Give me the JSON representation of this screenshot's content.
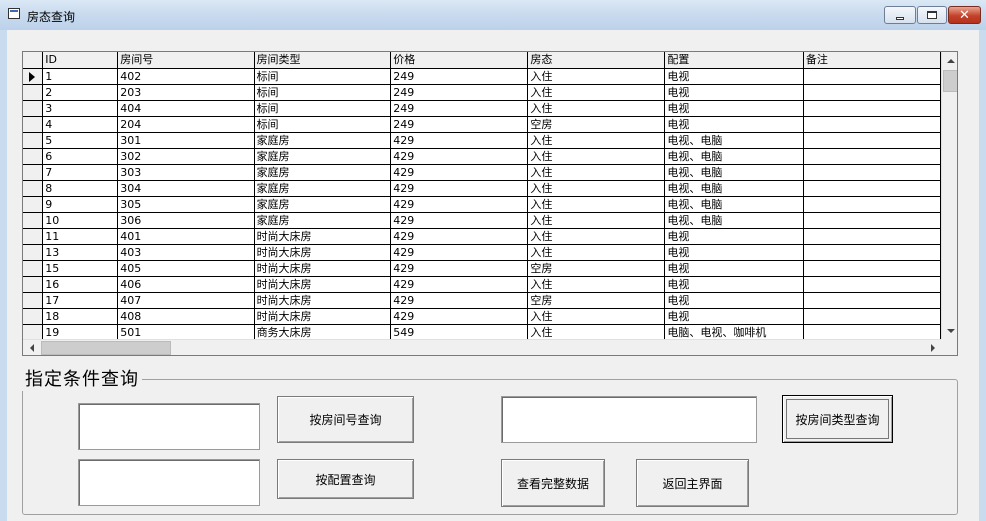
{
  "window": {
    "title": "房态查询"
  },
  "grid": {
    "columns": [
      "ID",
      "房间号",
      "房间类型",
      "价格",
      "房态",
      "配置",
      "备注"
    ],
    "rows": [
      [
        "1",
        "402",
        "标间",
        "249",
        "入住",
        "电视",
        ""
      ],
      [
        "2",
        "203",
        "标间",
        "249",
        "入住",
        "电视",
        ""
      ],
      [
        "3",
        "404",
        "标间",
        "249",
        "入住",
        "电视",
        ""
      ],
      [
        "4",
        "204",
        "标间",
        "249",
        "空房",
        "电视",
        ""
      ],
      [
        "5",
        "301",
        "家庭房",
        "429",
        "入住",
        "电视、电脑",
        ""
      ],
      [
        "6",
        "302",
        "家庭房",
        "429",
        "入住",
        "电视、电脑",
        ""
      ],
      [
        "7",
        "303",
        "家庭房",
        "429",
        "入住",
        "电视、电脑",
        ""
      ],
      [
        "8",
        "304",
        "家庭房",
        "429",
        "入住",
        "电视、电脑",
        ""
      ],
      [
        "9",
        "305",
        "家庭房",
        "429",
        "入住",
        "电视、电脑",
        ""
      ],
      [
        "10",
        "306",
        "家庭房",
        "429",
        "入住",
        "电视、电脑",
        ""
      ],
      [
        "11",
        "401",
        "时尚大床房",
        "429",
        "入住",
        "电视",
        ""
      ],
      [
        "13",
        "403",
        "时尚大床房",
        "429",
        "入住",
        "电视",
        ""
      ],
      [
        "15",
        "405",
        "时尚大床房",
        "429",
        "空房",
        "电视",
        ""
      ],
      [
        "16",
        "406",
        "时尚大床房",
        "429",
        "入住",
        "电视",
        ""
      ],
      [
        "17",
        "407",
        "时尚大床房",
        "429",
        "空房",
        "电视",
        ""
      ],
      [
        "18",
        "408",
        "时尚大床房",
        "429",
        "入住",
        "电视",
        ""
      ],
      [
        "19",
        "501",
        "商务大床房",
        "549",
        "入住",
        "电脑、电视、咖啡机",
        ""
      ]
    ]
  },
  "search": {
    "group_title": "指定条件查询",
    "room_number_input": "",
    "config_input": "",
    "room_type_input": "",
    "btn_by_room_number": "按房间号查询",
    "btn_by_config": "按配置查询",
    "btn_by_room_type": "按房间类型查询",
    "btn_full_data": "查看完整数据",
    "btn_back_main": "返回主界面"
  }
}
